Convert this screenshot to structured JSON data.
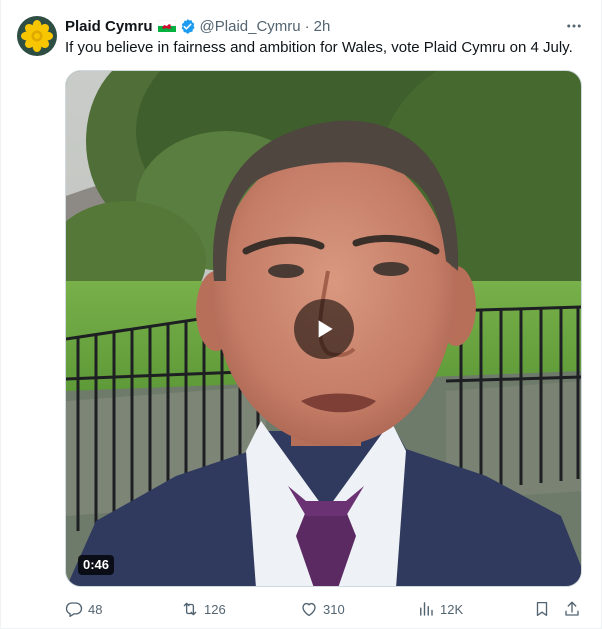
{
  "author": {
    "name": "Plaid Cymru",
    "handle": "@Plaid_Cymru",
    "separator": "·",
    "time": "2h"
  },
  "tweet": {
    "text": "If you believe in fairness and ambition for Wales, vote Plaid Cymru on 4 July."
  },
  "media": {
    "duration": "0:46"
  },
  "actions": {
    "replies": "48",
    "reposts": "126",
    "likes": "310",
    "views": "12K"
  },
  "icons": {
    "avatar": "daffodil-logo",
    "flag": "wales-flag",
    "verified": "verified-badge",
    "more": "more-icon",
    "reply": "reply-icon",
    "repost": "repost-icon",
    "like": "heart-icon",
    "views": "views-icon",
    "bookmark": "bookmark-icon",
    "share": "share-icon"
  },
  "colors": {
    "accent": "#1d9bf0",
    "secondary_text": "#536471",
    "avatar_bg": "#2e4e44",
    "logo_yellow": "#f7c600"
  }
}
